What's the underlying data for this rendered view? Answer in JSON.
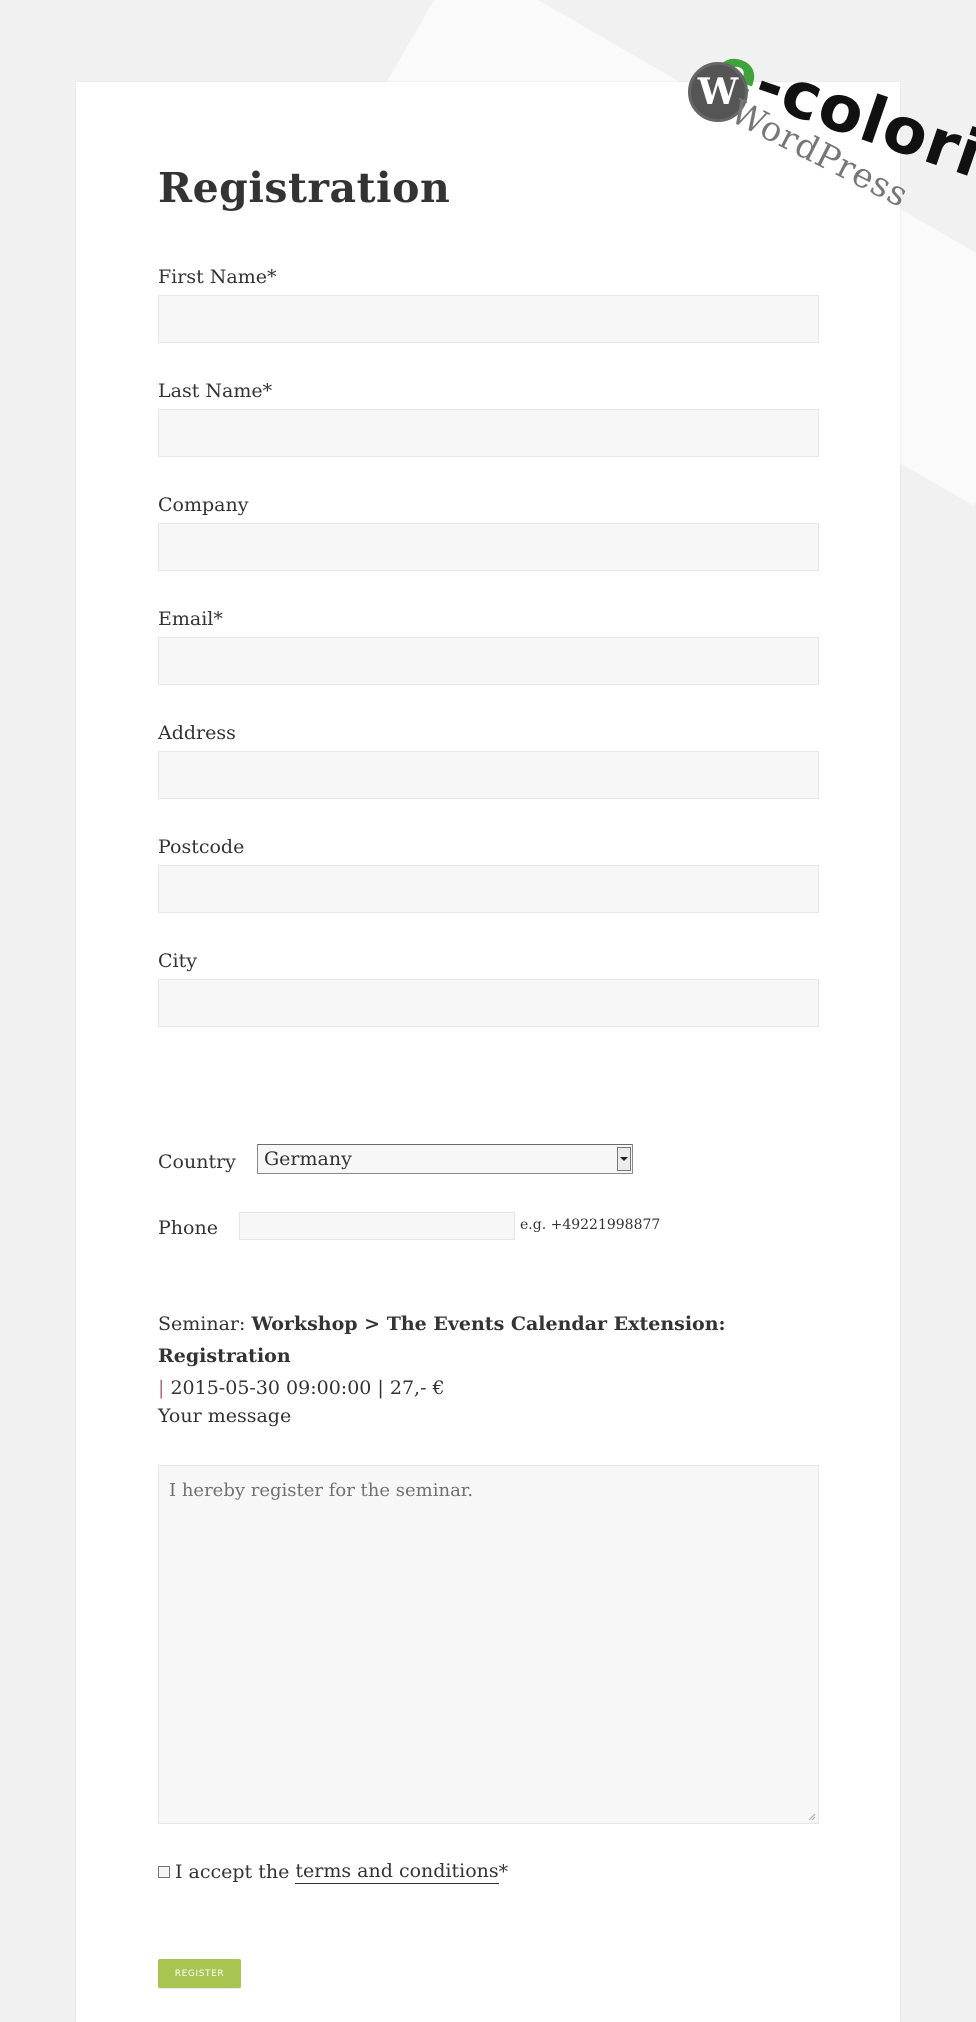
{
  "page": {
    "title": "Registration"
  },
  "form": {
    "fields": [
      {
        "label": "First Name*",
        "value": ""
      },
      {
        "label": "Last Name*",
        "value": ""
      },
      {
        "label": "Company",
        "value": ""
      },
      {
        "label": "Email*",
        "value": ""
      },
      {
        "label": "Address",
        "value": ""
      },
      {
        "label": "Postcode",
        "value": ""
      },
      {
        "label": "City",
        "value": ""
      }
    ],
    "country": {
      "label": "Country",
      "selected": "Germany"
    },
    "phone": {
      "label": "Phone",
      "value": "",
      "hint": "e.g. +49221998877"
    }
  },
  "seminar": {
    "prefix": "Seminar:",
    "name": "Workshop > The Events Calendar Extension: Registration",
    "separator": "|",
    "datetime": "2015-05-30 09:00:00",
    "price": "27,- €"
  },
  "message": {
    "label": "Your message",
    "text": "I hereby register for the seminar."
  },
  "terms": {
    "prefix": "I accept the",
    "link": "terms and conditions",
    "suffix": "*"
  },
  "actions": {
    "register": "REGISTER"
  },
  "logo": {
    "brand_e": "e",
    "brand_rest": "-colori",
    "wp_letter": "W",
    "wp_word": "WordPress"
  },
  "colors": {
    "accent_green": "#a9c551",
    "background": "#f1f1f1",
    "card": "#ffffff",
    "input_bg": "#f7f7f7"
  }
}
